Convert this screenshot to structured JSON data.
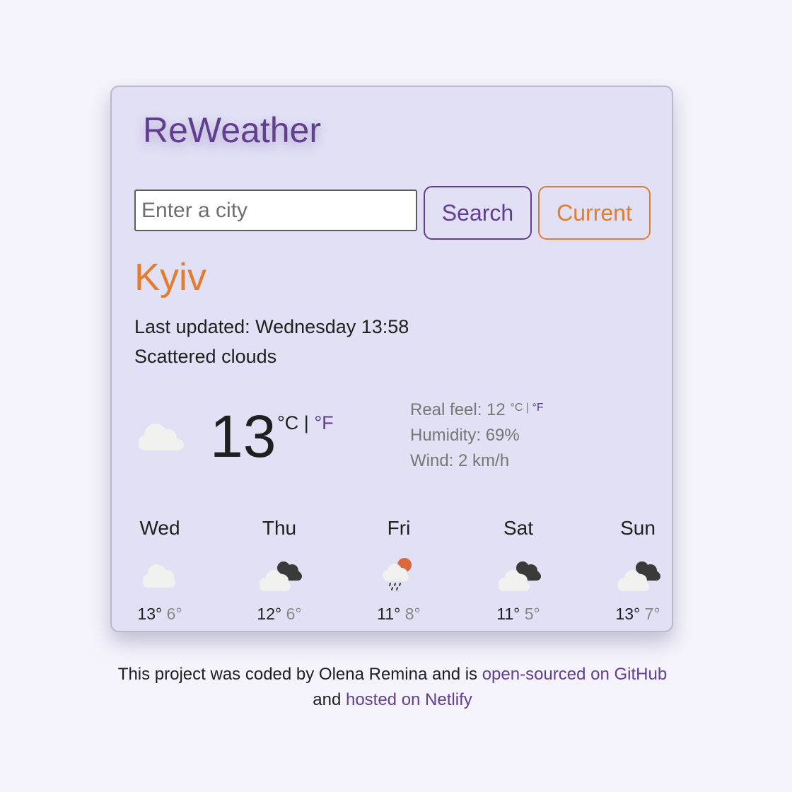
{
  "app": {
    "title": "ReWeather"
  },
  "search": {
    "placeholder": "Enter a city",
    "value": "",
    "search_label": "Search",
    "current_label": "Current"
  },
  "current": {
    "city": "Kyiv",
    "last_updated": "Last updated: Wednesday 13:58",
    "description": "Scattered clouds",
    "icon": "cloud-icon",
    "temperature": "13",
    "unit_c": "°C",
    "unit_sep": " | ",
    "unit_f": "°F",
    "real_feel_label": "Real feel: 12",
    "real_feel_unit_c": "°C",
    "real_feel_sep": " | ",
    "real_feel_unit_f": "°F",
    "humidity": "Humidity: 69%",
    "wind": "Wind: 2 km/h"
  },
  "forecast": [
    {
      "day": "Wed",
      "icon": "cloud-icon",
      "max": "13°",
      "min": "6°"
    },
    {
      "day": "Thu",
      "icon": "broken-clouds-icon",
      "max": "12°",
      "min": "6°"
    },
    {
      "day": "Fri",
      "icon": "sun-rain-cloud-icon",
      "max": "11°",
      "min": "8°"
    },
    {
      "day": "Sat",
      "icon": "broken-clouds-icon",
      "max": "11°",
      "min": "5°"
    },
    {
      "day": "Sun",
      "icon": "broken-clouds-icon",
      "max": "13°",
      "min": "7°"
    }
  ],
  "footer": {
    "text_1": "This project was coded by Olena Remina and is ",
    "link_github": "open-sourced on GitHub",
    "text_2": "and ",
    "link_netlify": "hosted on Netlify"
  },
  "colors": {
    "accent_purple": "#613e8e",
    "accent_orange": "#e27d2e",
    "card_background": "#e1e0f5",
    "page_background": "#f5f4fc"
  }
}
